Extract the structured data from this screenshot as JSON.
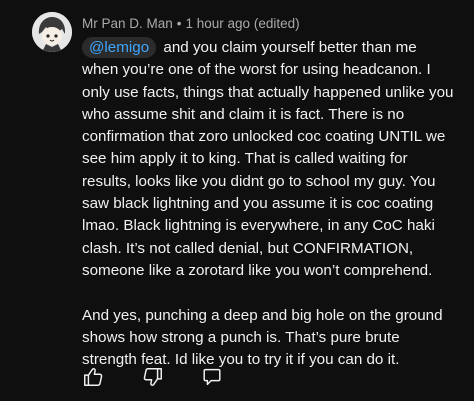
{
  "comment": {
    "author": "Mr Pan D. Man",
    "separator": "•",
    "timestamp": "1 hour ago (edited)",
    "mention": "@lemigo",
    "paragraphs": [
      "and you claim yourself better than me when you’re one of the worst for using headcanon. I only use facts, things that actually happened unlike you who assume shit and claim it is fact. There is no confirmation that zoro unlocked coc coating UNTIL we see him apply it to king. That is called waiting for results, looks like you didnt go to school my guy. You saw black lightning and you assume it is coc coating lmao. Black lightning is everywhere, in any CoC haki clash. It’s not called denial, but CONFIRMATION, someone like a zorotard like you won’t comprehend.",
      "And yes, punching a deep and big hole on the ground shows how strong a punch is. That’s pure brute strength feat. Id like you to try it if you can do it."
    ]
  },
  "icons": {
    "avatar": "avatar-image",
    "like": "thumbs-up-icon",
    "dislike": "thumbs-down-icon",
    "reply": "reply-icon"
  },
  "colors": {
    "background": "#0f0f0f",
    "text": "#f1f1f1",
    "meta_text": "#aaaaaa",
    "mention": "#3ea6ff",
    "mention_bg": "#2b2b2b"
  }
}
